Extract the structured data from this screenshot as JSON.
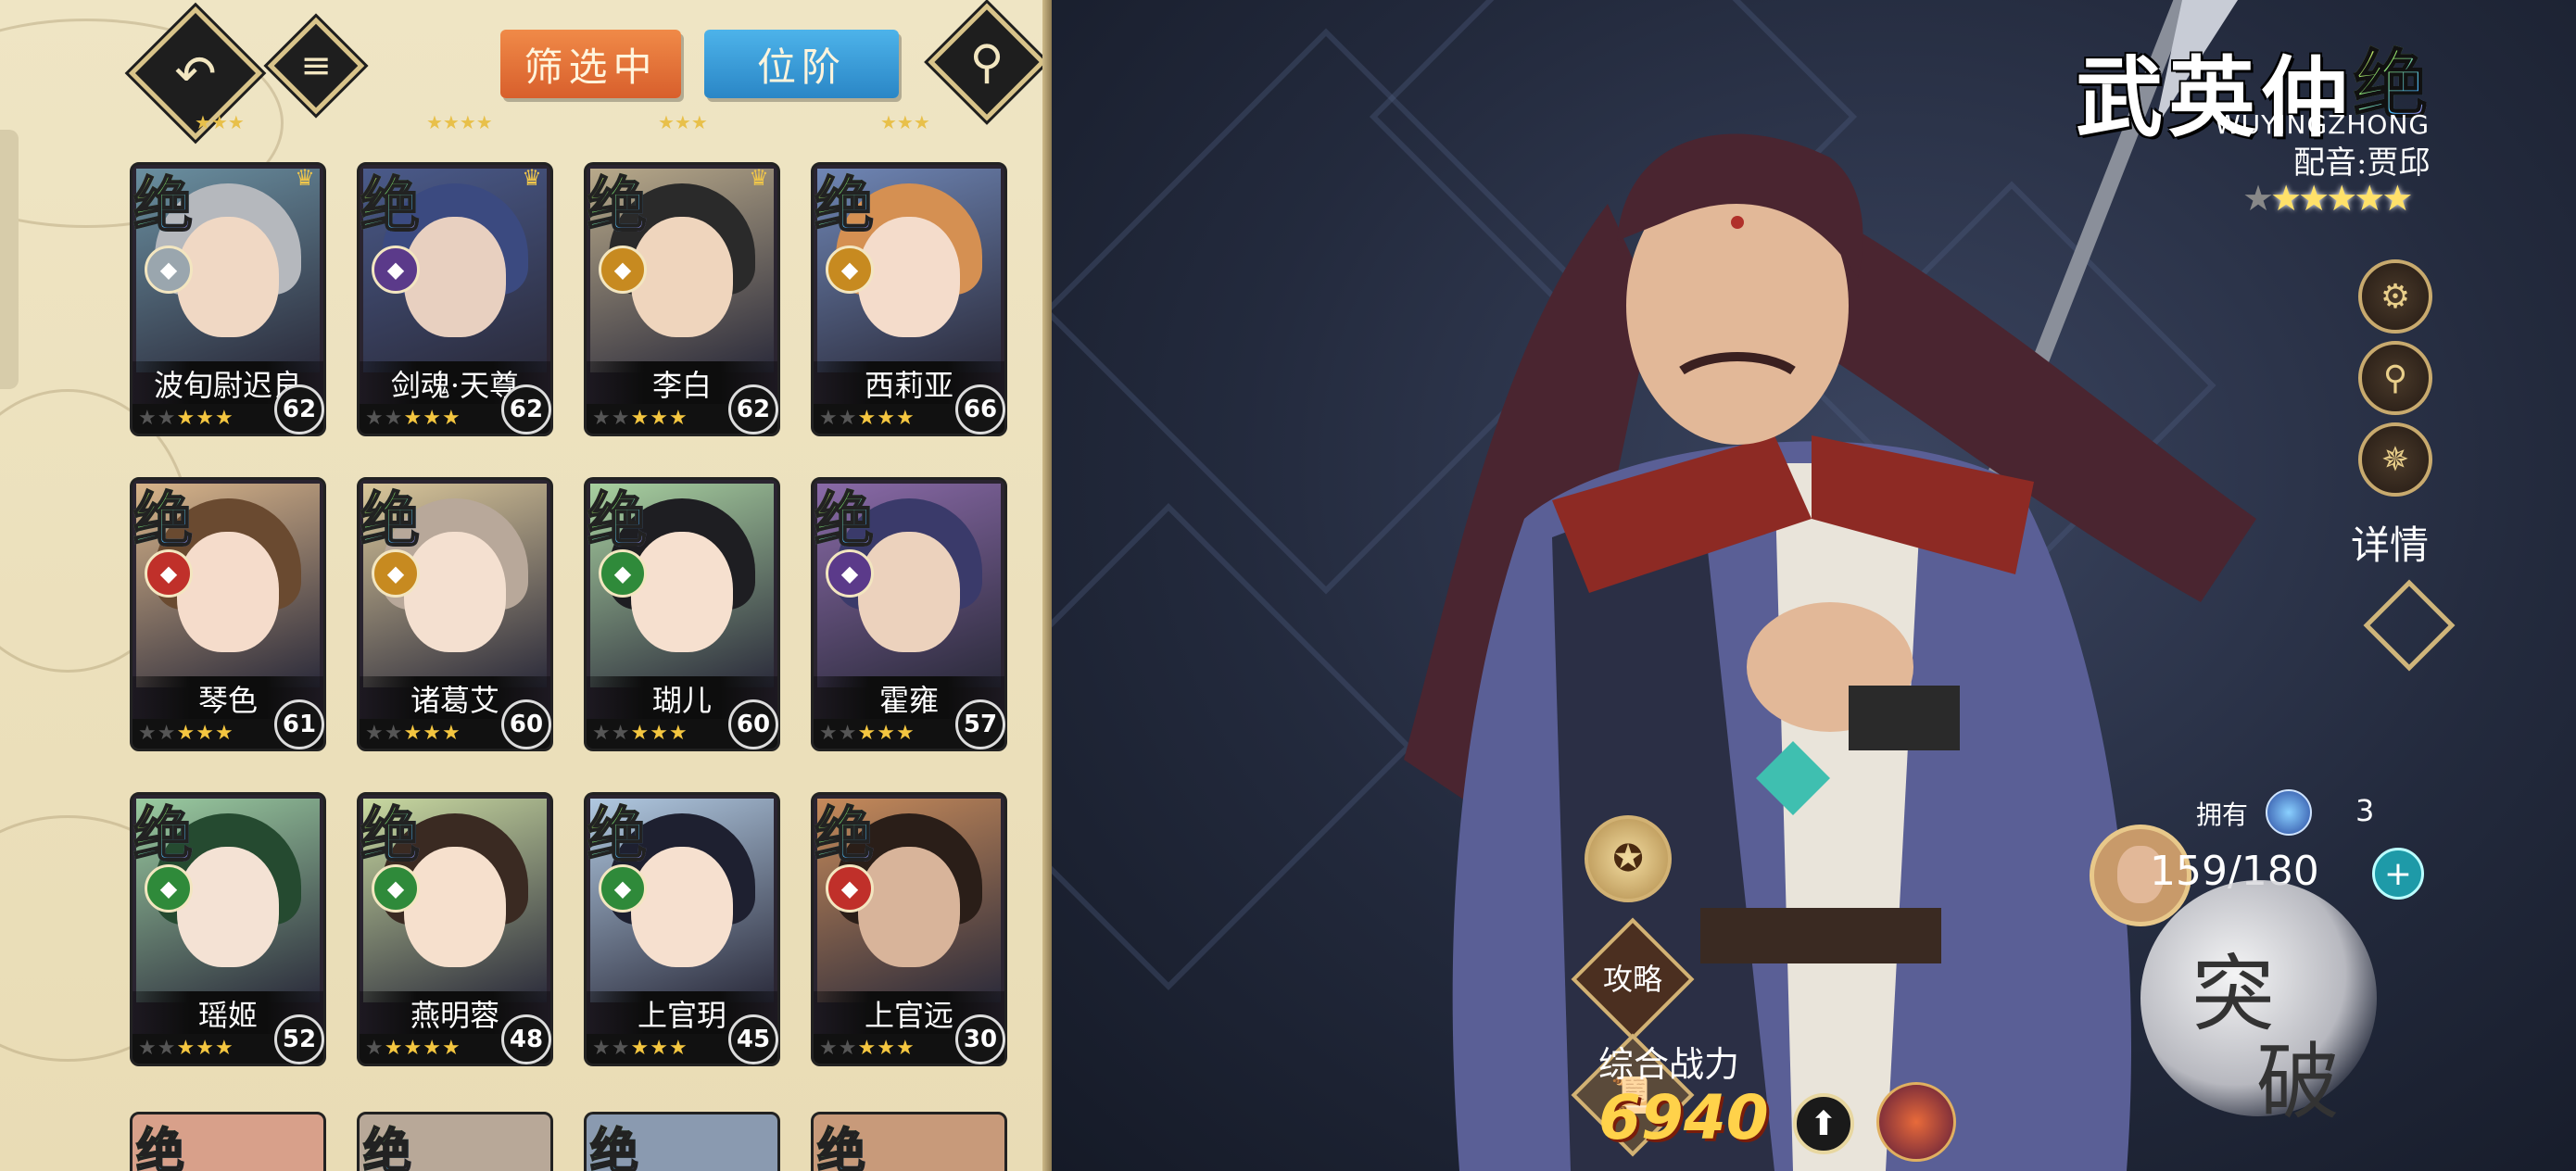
{
  "toolbar": {
    "filter_label": "筛选中",
    "rank_label": "位阶"
  },
  "heroes": [
    {
      "grade": "绝",
      "name": "波旬尉迟良",
      "level": "62",
      "stars": 5,
      "gold_stars": 3,
      "class_color": "#9aa6ae",
      "face_color": "#f0d8c4",
      "hair_color": "#b5b8bd",
      "bg": "#6a8fa0",
      "crown": true
    },
    {
      "grade": "绝",
      "name": "剑魂·天尊",
      "level": "62",
      "stars": 5,
      "gold_stars": 3,
      "class_color": "#5b3a8a",
      "face_color": "#e8d0c0",
      "hair_color": "#3b4a80",
      "bg": "#4a5a8a",
      "crown": true
    },
    {
      "grade": "绝",
      "name": "李白",
      "level": "62",
      "stars": 5,
      "gold_stars": 3,
      "class_color": "#c78a20",
      "face_color": "#efd5bd",
      "hair_color": "#2a2a2a",
      "bg": "#b8a98a",
      "crown": true
    },
    {
      "grade": "绝",
      "name": "西莉亚",
      "level": "66",
      "stars": 5,
      "gold_stars": 3,
      "class_color": "#c78a20",
      "face_color": "#f4dccb",
      "hair_color": "#d59052",
      "bg": "#6f86b5",
      "crown": false
    },
    {
      "grade": "绝",
      "name": "琴色",
      "level": "61",
      "stars": 5,
      "gold_stars": 3,
      "class_color": "#c0302a",
      "face_color": "#f5dccb",
      "hair_color": "#6a4a30",
      "bg": "#d8b48a",
      "crown": false
    },
    {
      "grade": "绝",
      "name": "诸葛艾",
      "level": "60",
      "stars": 5,
      "gold_stars": 3,
      "class_color": "#c78a20",
      "face_color": "#f4e0d0",
      "hair_color": "#b8a89a",
      "bg": "#d9c69a",
      "crown": false
    },
    {
      "grade": "绝",
      "name": "瑚儿",
      "level": "60",
      "stars": 5,
      "gold_stars": 3,
      "class_color": "#2f8a3a",
      "face_color": "#f6e0cf",
      "hair_color": "#1e1e22",
      "bg": "#a8d0a0",
      "crown": false
    },
    {
      "grade": "绝",
      "name": "霍雍",
      "level": "57",
      "stars": 5,
      "gold_stars": 3,
      "class_color": "#5b3a8a",
      "face_color": "#ecd2bd",
      "hair_color": "#3a3a6a",
      "bg": "#8a6aa8",
      "crown": false
    },
    {
      "grade": "绝",
      "name": "瑶姬",
      "level": "52",
      "stars": 5,
      "gold_stars": 3,
      "class_color": "#2f8a3a",
      "face_color": "#f4e2d4",
      "hair_color": "#254a30",
      "bg": "#9acba0",
      "crown": false
    },
    {
      "grade": "绝",
      "name": "燕明蓉",
      "level": "48",
      "stars": 5,
      "gold_stars": 4,
      "class_color": "#2f8a3a",
      "face_color": "#f6e0cd",
      "hair_color": "#3a2a22",
      "bg": "#c8d8a0",
      "crown": false
    },
    {
      "grade": "绝",
      "name": "上官玥",
      "level": "45",
      "stars": 5,
      "gold_stars": 3,
      "class_color": "#2f8a3a",
      "face_color": "#f6e0cf",
      "hair_color": "#1e2030",
      "bg": "#b0c8e0",
      "crown": false
    },
    {
      "grade": "绝",
      "name": "上官远",
      "level": "30",
      "stars": 5,
      "gold_stars": 3,
      "class_color": "#c0302a",
      "face_color": "#d8b49a",
      "hair_color": "#2a1e18",
      "bg": "#c68a5a",
      "crown": false
    }
  ],
  "hero_detail": {
    "name": "武英仲",
    "grade": "绝",
    "pinyin": "WUYINGZHONG",
    "voice": "配音:贾邱",
    "stars": 5,
    "detail_label": "详情",
    "own_label": "拥有",
    "own_count": "3",
    "fragments": "159/180",
    "power_label": "综合战力",
    "power_value": "6940",
    "break_label": "突破",
    "guide_label": "攻略"
  },
  "colors": {
    "panel_bg": "#efe5c4",
    "filter_btn": "#e4743a",
    "rank_btn": "#3a9fd8",
    "power_gold": "#ffd24a"
  }
}
